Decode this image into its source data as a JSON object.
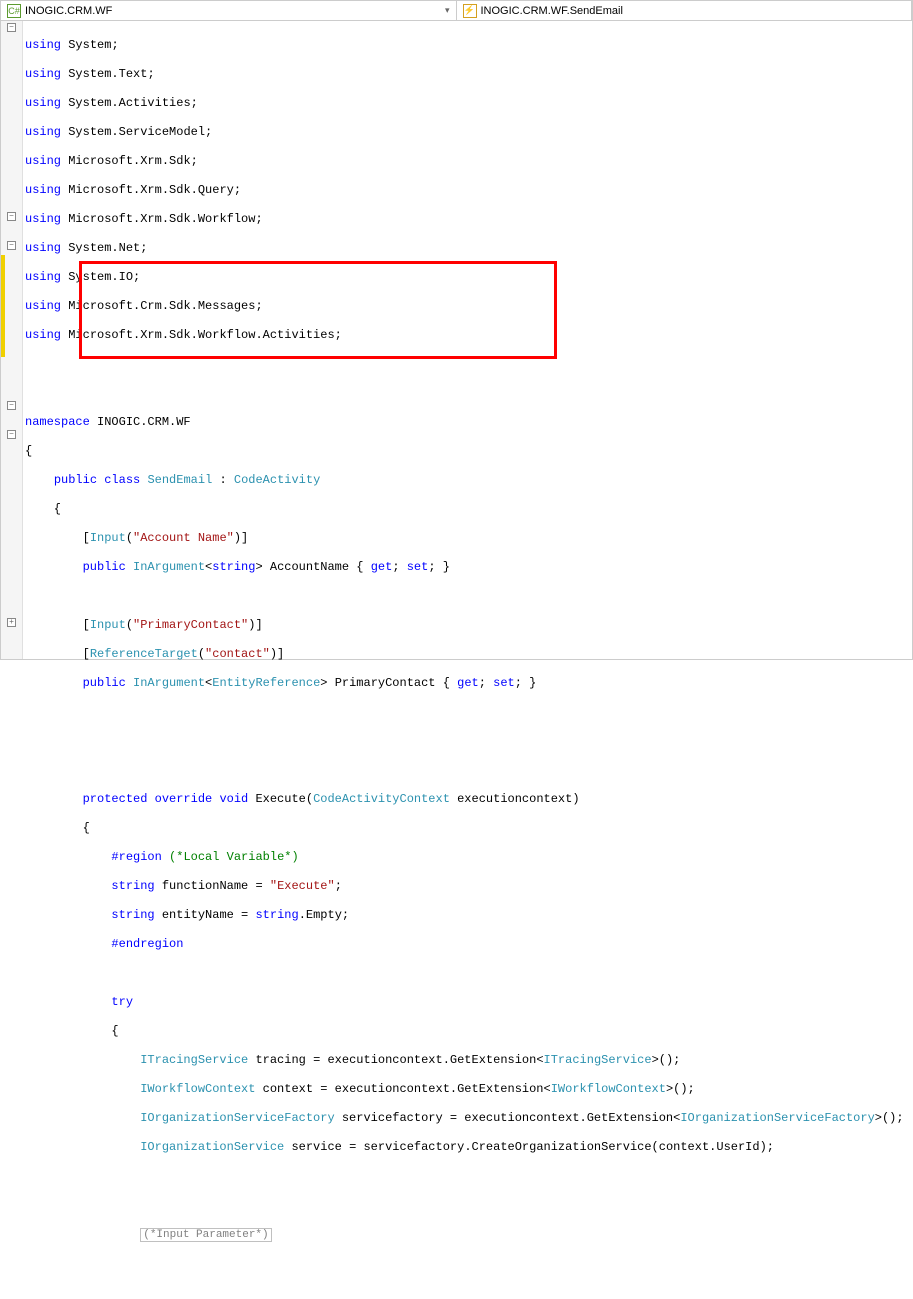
{
  "tabs": {
    "left": {
      "icon_label": "C#",
      "text": "INOGIC.CRM.WF"
    },
    "right": {
      "icon_label": "⚡",
      "text": "INOGIC.CRM.WF.SendEmail"
    }
  },
  "kw": {
    "using": "using",
    "namespace": "namespace",
    "public": "public",
    "class": "class",
    "protected": "protected",
    "override": "override",
    "void": "void",
    "string": "string",
    "try": "try",
    "get": "get",
    "set": "set"
  },
  "types": {
    "SendEmail": "SendEmail",
    "CodeActivity": "CodeActivity",
    "Input": "Input",
    "InArgument": "InArgument",
    "ReferenceTarget": "ReferenceTarget",
    "EntityReference": "EntityReference",
    "CodeActivityContext": "CodeActivityContext",
    "ITracingService": "ITracingService",
    "IWorkflowContext": "IWorkflowContext",
    "IOrganizationServiceFactory": "IOrganizationServiceFactory",
    "IOrganizationService": "IOrganizationService"
  },
  "str": {
    "accountName": "\"Account Name\"",
    "primaryContact": "\"PrimaryContact\"",
    "contact": "\"contact\"",
    "execute": "\"Execute\"",
    "regionLocal": "(*Local Variable*)",
    "inputParam": "(*Input Parameter*)"
  },
  "id": {
    "ns": "INOGIC.CRM.WF",
    "AccountName": "AccountName",
    "PrimaryContact": "PrimaryContact",
    "Execute": "Execute",
    "executioncontext": "executioncontext",
    "functionName": "functionName",
    "entityName": "entityName",
    "Empty": "Empty",
    "tracing": "tracing",
    "context": "context",
    "servicefactory": "servicefactory",
    "service": "service",
    "GetExtension": "GetExtension",
    "CreateOrganizationService": "CreateOrganizationService",
    "UserId": "UserId",
    "region": "region",
    "endregion": "endregion"
  },
  "usings": [
    "System",
    "System.Text",
    "System.Activities",
    "System.ServiceModel",
    "Microsoft.Xrm.Sdk",
    "Microsoft.Xrm.Sdk.Query",
    "Microsoft.Xrm.Sdk.Workflow",
    "System.Net",
    "System.IO",
    "Microsoft.Crm.Sdk.Messages",
    "Microsoft.Xrm.Sdk.Workflow.Activities"
  ]
}
